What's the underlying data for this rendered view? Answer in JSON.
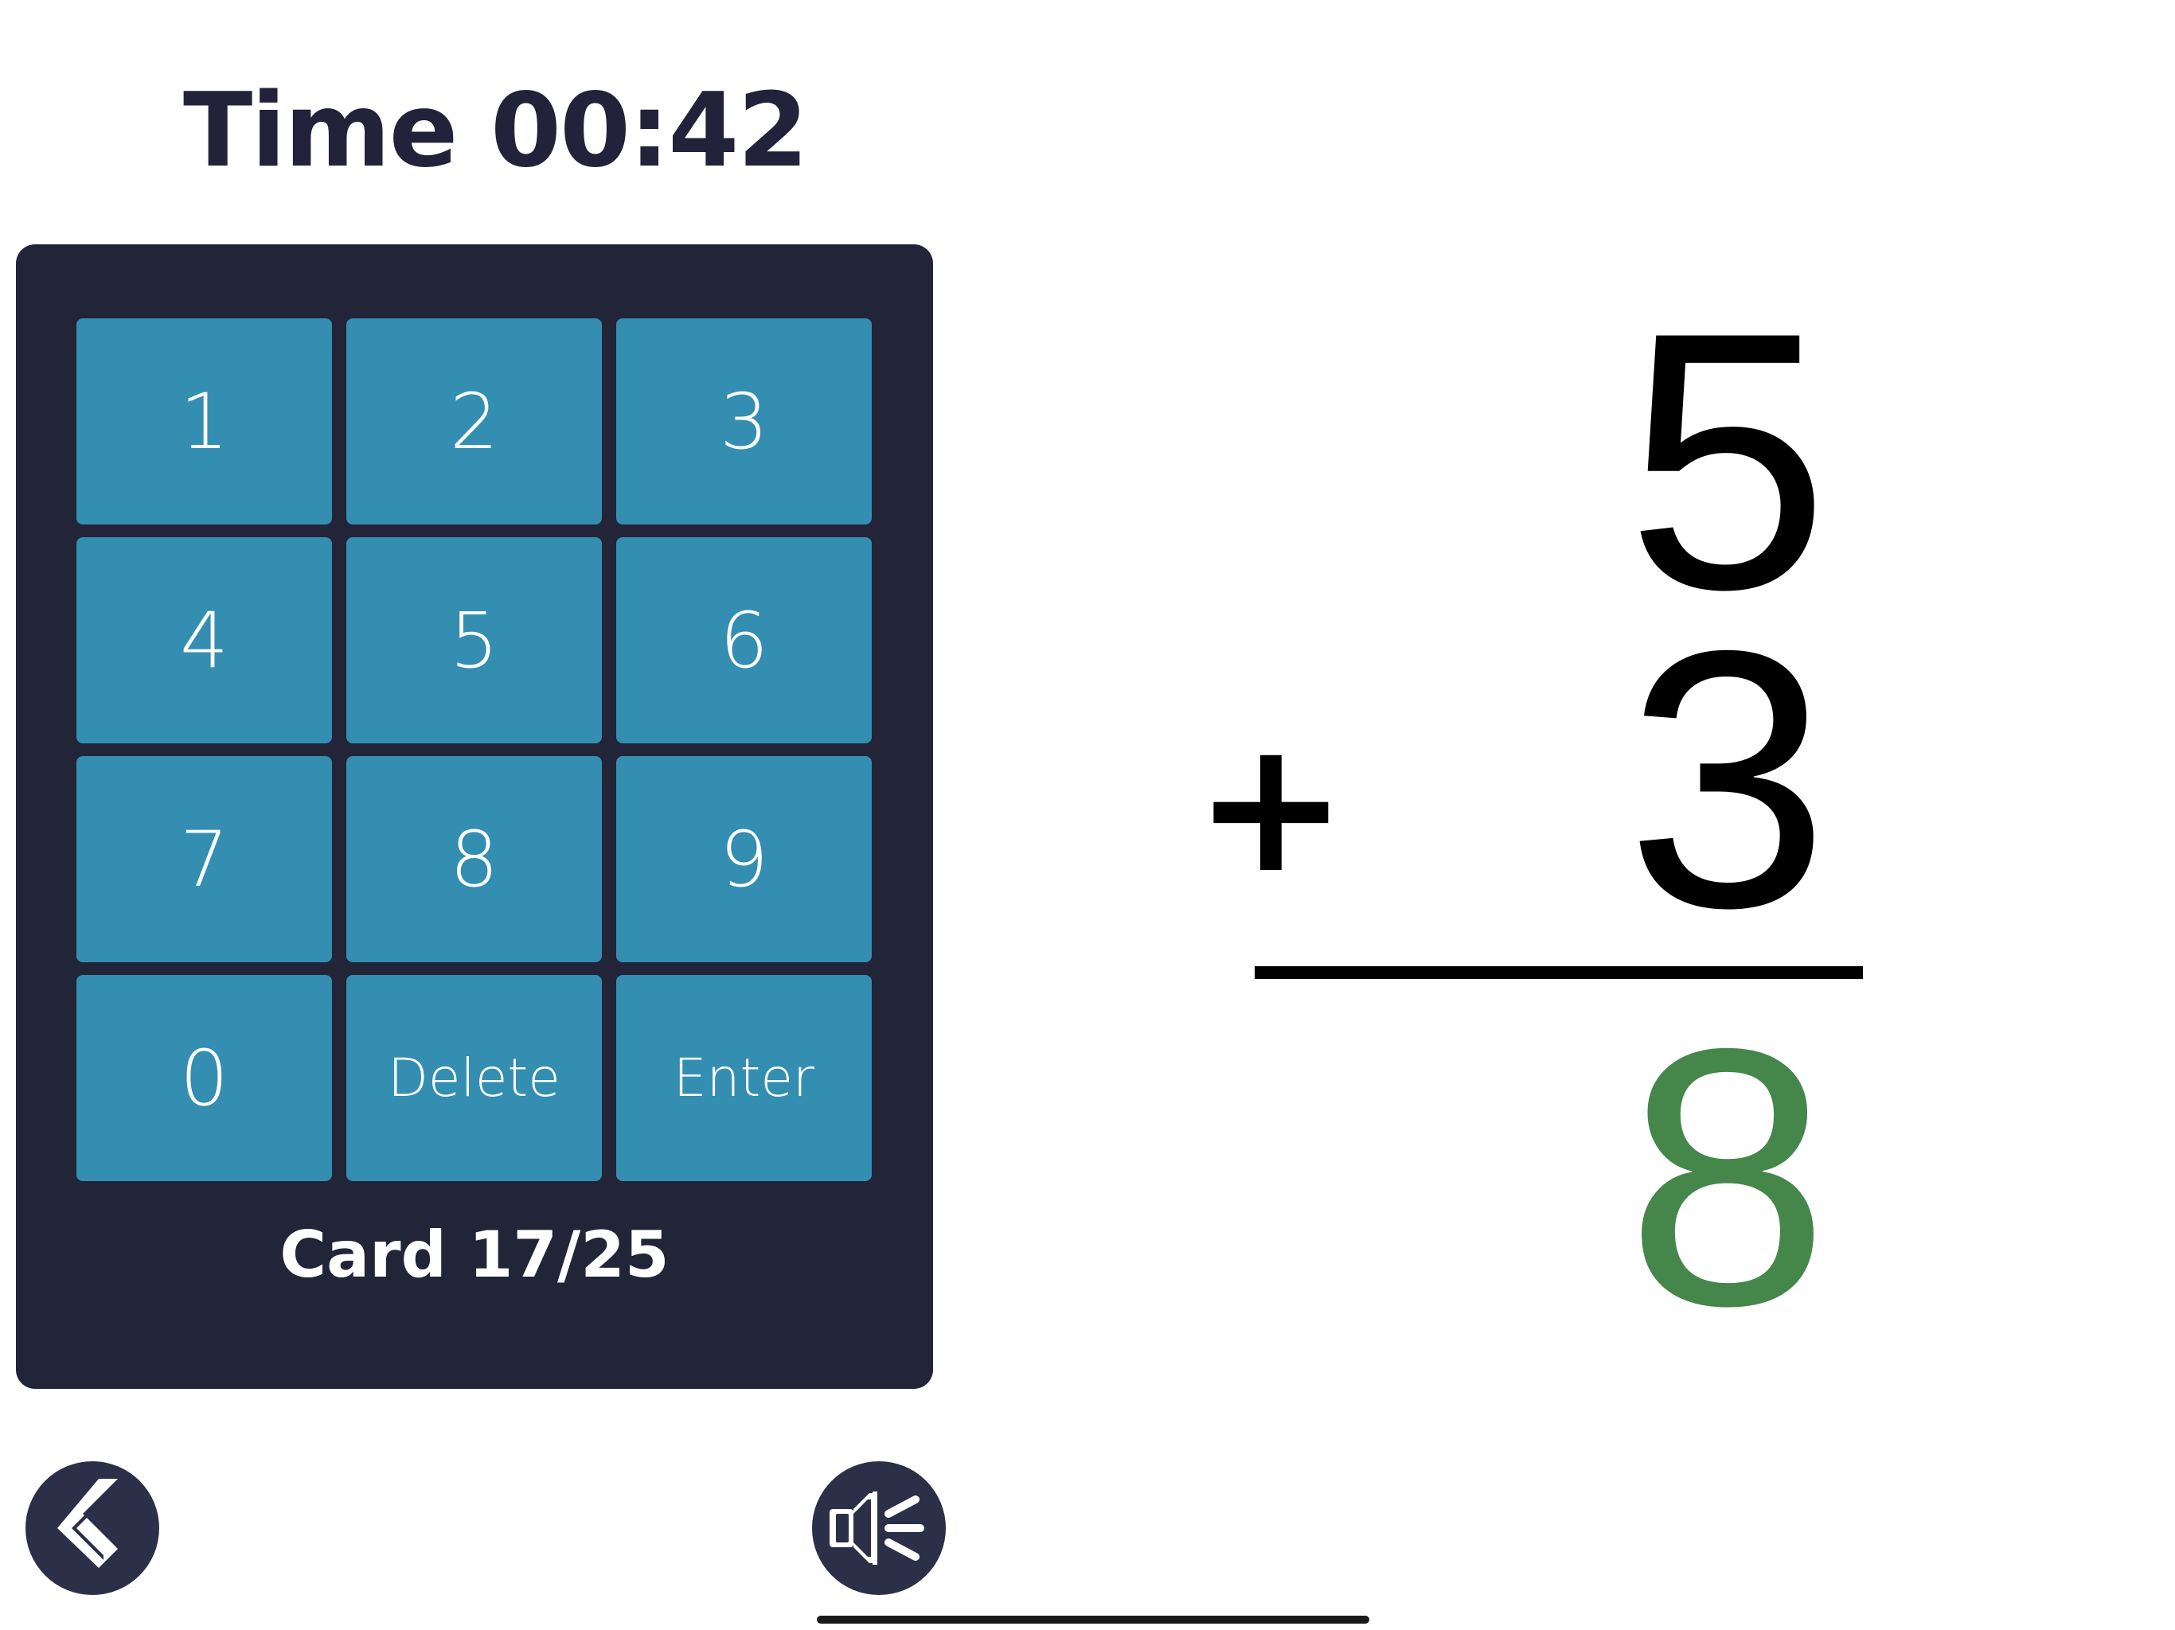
{
  "timer": {
    "label": "Time 00:42"
  },
  "keypad": {
    "keys": [
      "1",
      "2",
      "3",
      "4",
      "5",
      "6",
      "7",
      "8",
      "9",
      "0",
      "Delete",
      "Enter"
    ]
  },
  "card_counter": {
    "label": "Card 17/25"
  },
  "problem": {
    "top_number": "5",
    "operator": "+",
    "bottom_number": "3",
    "answer": "8"
  },
  "colors": {
    "panel": "#222438",
    "key": "#338eb2",
    "answer": "#45874a",
    "round_button": "#2c2f48"
  },
  "icons": {
    "back": "chevron-left-icon",
    "speaker": "speaker-icon"
  }
}
